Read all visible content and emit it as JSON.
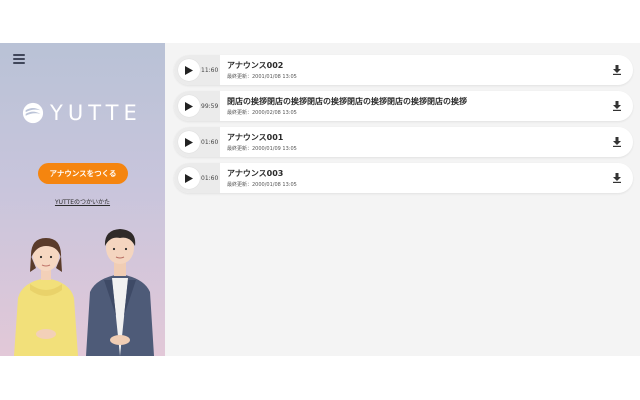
{
  "brand": {
    "name": "YUTTE",
    "color": "#f5850f"
  },
  "sidebar": {
    "create_label": "アナウンスをつくる",
    "howto_label": "YUTTEのつかいかた"
  },
  "announcements": [
    {
      "duration": "11:60",
      "title": "アナウンス002",
      "date": "最終更新：2001/01/08 13:05"
    },
    {
      "duration": "99:59",
      "title": "閉店の挨拶閉店の挨拶閉店の挨拶閉店の挨拶閉店の挨拶閉店の挨拶",
      "date": "最終更新：2000/02/08 13:05"
    },
    {
      "duration": "01:60",
      "title": "アナウンス001",
      "date": "最終更新：2000/01/09 13:05"
    },
    {
      "duration": "01:60",
      "title": "アナウンス003",
      "date": "最終更新：2000/01/08 13:05"
    }
  ],
  "icons": {
    "menu": "hamburger-icon",
    "play": "play-icon",
    "download": "download-icon"
  }
}
